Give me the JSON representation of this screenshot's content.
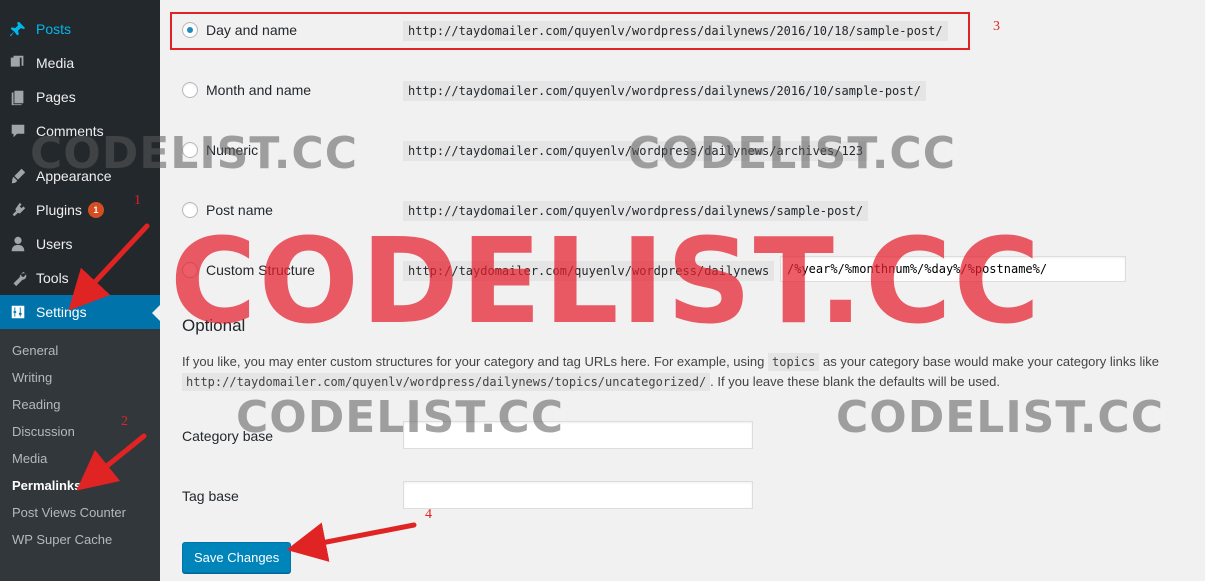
{
  "sidebar": {
    "items": [
      {
        "label": "Posts",
        "icon": "pin-icon"
      },
      {
        "label": "Media",
        "icon": "media-icon"
      },
      {
        "label": "Pages",
        "icon": "pages-icon"
      },
      {
        "label": "Comments",
        "icon": "comments-icon"
      },
      {
        "label": "Appearance",
        "icon": "brush-icon"
      },
      {
        "label": "Plugins",
        "icon": "plugin-icon",
        "badge": "1"
      },
      {
        "label": "Users",
        "icon": "users-icon"
      },
      {
        "label": "Tools",
        "icon": "wrench-icon"
      },
      {
        "label": "Settings",
        "icon": "settings-icon"
      }
    ],
    "submenu": [
      "General",
      "Writing",
      "Reading",
      "Discussion",
      "Media",
      "Permalinks",
      "Post Views Counter",
      "WP Super Cache"
    ]
  },
  "permalinks": {
    "options": [
      {
        "label": "Day and name",
        "example": "http://taydomailer.com/quyenlv/wordpress/dailynews/2016/10/18/sample-post/",
        "checked": true
      },
      {
        "label": "Month and name",
        "example": "http://taydomailer.com/quyenlv/wordpress/dailynews/2016/10/sample-post/"
      },
      {
        "label": "Numeric",
        "example": "http://taydomailer.com/quyenlv/wordpress/dailynews/archives/123"
      },
      {
        "label": "Post name",
        "example": "http://taydomailer.com/quyenlv/wordpress/dailynews/sample-post/"
      },
      {
        "label": "Custom Structure",
        "example": "http://taydomailer.com/quyenlv/wordpress/dailynews"
      }
    ],
    "custom_structure_value": "/%year%/%monthnum%/%day%/%postname%/"
  },
  "optional": {
    "heading": "Optional",
    "desc_part1": "If you like, you may enter custom structures for your category and tag URLs here. For example, using",
    "desc_code1": "topics",
    "desc_part2": "as your category base would make your category links like",
    "desc_code2": "http://taydomailer.com/quyenlv/wordpress/dailynews/topics/uncategorized/",
    "desc_part3": ". If you leave these blank the defaults will be used.",
    "category_base_label": "Category base",
    "category_base_value": "",
    "tag_base_label": "Tag base",
    "tag_base_value": ""
  },
  "save_button": "Save Changes",
  "watermarks": {
    "big": "CODELIST.CC",
    "small": "CODELIST.CC"
  },
  "annotations": [
    "1",
    "2",
    "3",
    "4"
  ],
  "colors": {
    "sidebar_bg": "#23282d",
    "submenu_bg": "#32373c",
    "active_bg": "#0073aa",
    "posts_link": "#00b9eb",
    "annotation_red": "#e02424",
    "primary_button": "#0085ba"
  }
}
